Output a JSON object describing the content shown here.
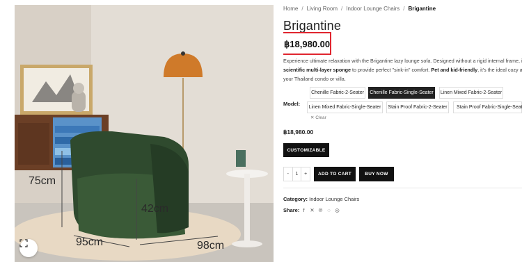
{
  "breadcrumb": {
    "items": [
      "Home",
      "Living Room",
      "Indoor Lounge Chairs"
    ],
    "current": "Brigantine",
    "separator": "/"
  },
  "product": {
    "title": "Brigantine",
    "price": "฿18,980.00",
    "description": {
      "p1": "Experience ultimate relaxation with the Brigantine lazy lounge sofa. Designed without a rigid internal frame, it us",
      "b1": "scientific multi-layer sponge",
      "p2": " to provide perfect \"sink-in\" comfort. ",
      "b2": "Pet and kid-friendly",
      "p3": ", it's the ideal cozy addit",
      "p4": "your Thailand condo or villa."
    },
    "selected_price": "฿18,980.00"
  },
  "gallery": {
    "dimensions": {
      "height": "75cm",
      "seat": "42cm",
      "depth": "95cm",
      "width": "98cm"
    }
  },
  "variations": {
    "label": "Model:",
    "options": [
      "Chenille Fabric-2-Seater",
      "Chenille Fabric-Single-Seater",
      "Linen Mixed Fabric-2-Seater",
      "Linen Mixed Fabric-Single-Seater",
      "Stain Proof Fabric-2-Seater",
      "Stain Proof Fabric-Single-Seater"
    ],
    "selected": "Chenille Fabric-Single-Seater",
    "clear_label": "Clear"
  },
  "actions": {
    "customizable": "CUSTOMIZABLE",
    "qty_minus": "-",
    "qty_value": "1",
    "qty_plus": "+",
    "add_to_cart": "ADD TO CART",
    "buy_now": "BUY NOW"
  },
  "meta": {
    "category_label": "Category:",
    "category_value": "Indoor Lounge Chairs",
    "share_label": "Share:",
    "share_icons": [
      "facebook-icon",
      "x-icon",
      "pinterest-icon",
      "whatsapp-icon",
      "instagram-icon"
    ]
  },
  "colors": {
    "accent_highlight": "#e0252f",
    "button": "#111111",
    "sofa": "#2f4a2e"
  }
}
